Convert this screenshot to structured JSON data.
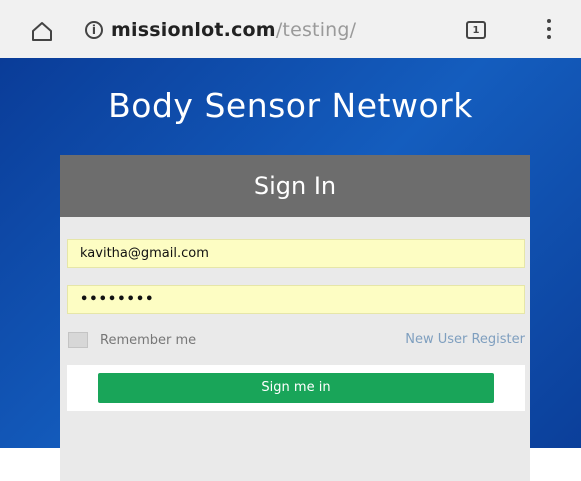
{
  "browser": {
    "url_domain": "missionlot.com",
    "url_path": "/testing/",
    "tab_count": "1",
    "info_symbol": "i"
  },
  "page": {
    "title": "Body Sensor Network"
  },
  "login": {
    "header": "Sign In",
    "email_value": "kavitha@gmail.com",
    "password_value": "••••••••",
    "remember_label": "Remember me",
    "register_link": "New User Register",
    "submit_label": "Sign me in"
  },
  "colors": {
    "page_background": "#0b3f9a",
    "card_header": "#6d6d6d",
    "input_background": "#fdfdc3",
    "submit_button": "#19a559",
    "register_link": "#7f9fbf"
  },
  "icons": [
    "home-icon",
    "info-icon",
    "tabs-icon",
    "menu-icon"
  ]
}
